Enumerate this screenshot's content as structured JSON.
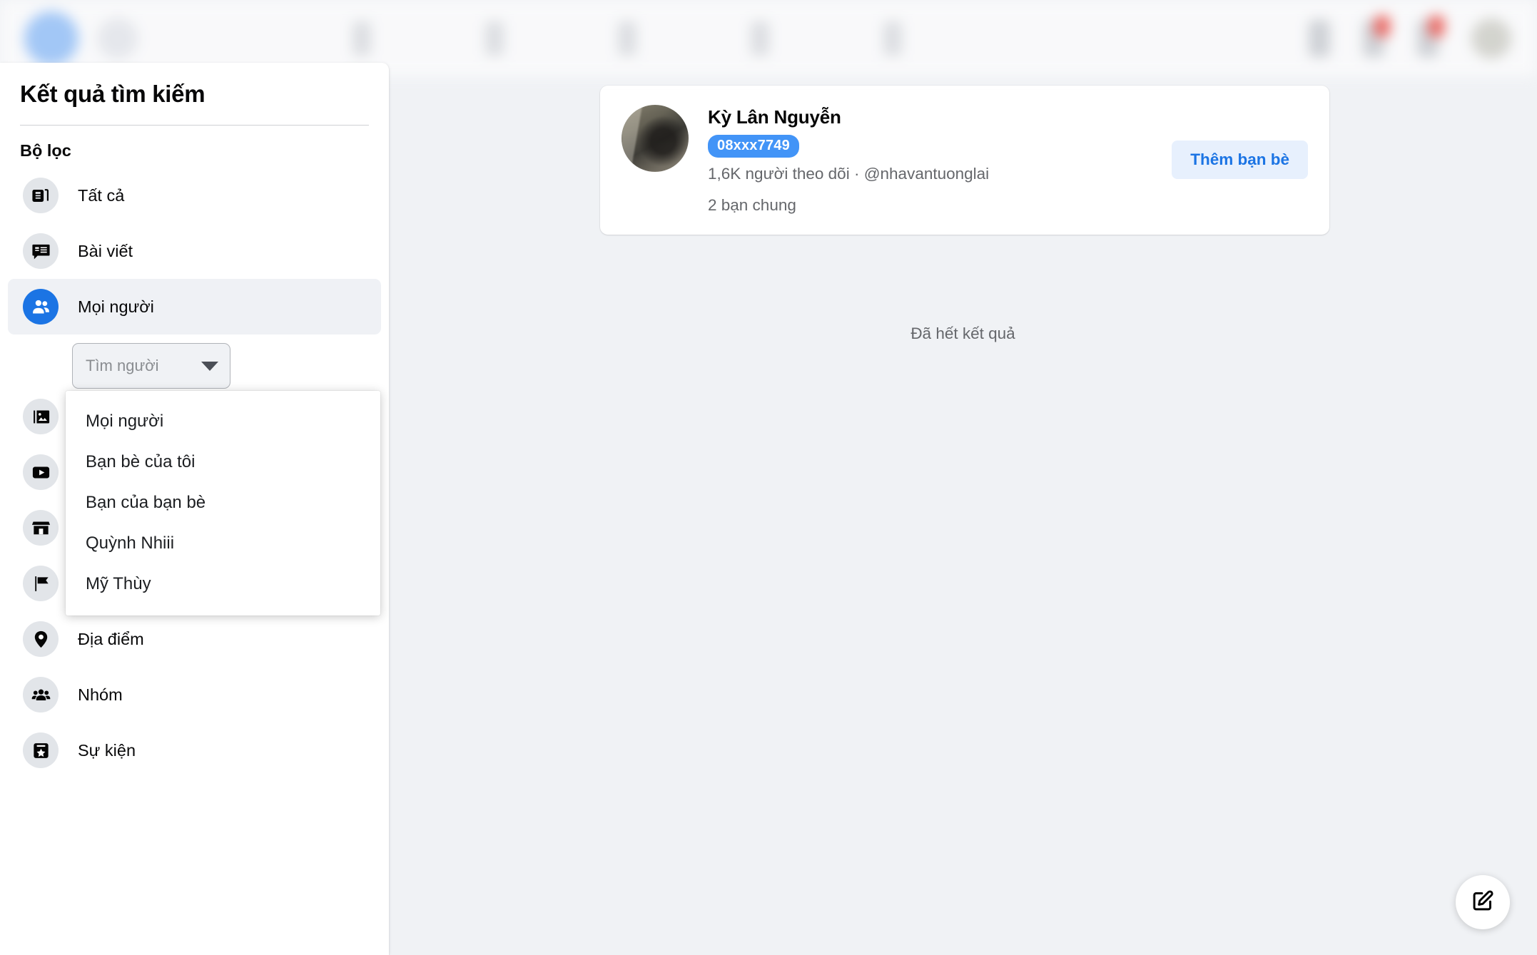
{
  "topbar": {
    "state": "blurred-loading",
    "logo_icon": "facebook-logo-icon",
    "search_icon": "search-icon",
    "nav_icon_count": 5,
    "right_icon_count": 3,
    "avatar_icon": "account-avatar",
    "notification_badge_color": "#e94c45",
    "brand_color": "#1877f2"
  },
  "sidebar": {
    "title": "Kết quả tìm kiếm",
    "filters_heading": "Bộ lọc",
    "items": [
      {
        "label": "Tất cả",
        "icon": "all-results-icon",
        "active": false
      },
      {
        "label": "Bài viết",
        "icon": "posts-icon",
        "active": false
      },
      {
        "label": "Mọi người",
        "icon": "people-icon",
        "active": true
      },
      {
        "label": "Ảnh",
        "icon": "photos-icon",
        "active": false
      },
      {
        "label": "Video",
        "icon": "video-icon",
        "active": false
      },
      {
        "label": "Marketplace",
        "icon": "marketplace-icon",
        "active": false
      },
      {
        "label": "Trang",
        "icon": "pages-icon",
        "active": false
      },
      {
        "label": "Địa điểm",
        "icon": "location-icon",
        "active": false
      },
      {
        "label": "Nhóm",
        "icon": "groups-icon",
        "active": false
      },
      {
        "label": "Sự kiện",
        "icon": "events-icon",
        "active": false
      }
    ],
    "people_select": {
      "placeholder": "Tìm người",
      "value": "",
      "caret_icon": "chevron-down-icon",
      "expanded": true,
      "options": [
        "Mọi người",
        "Bạn bè của tôi",
        "Bạn của bạn bè",
        "Quỳnh Nhiii",
        "Mỹ Thùy"
      ]
    }
  },
  "main": {
    "result": {
      "avatar": "profile-photo",
      "name": "Kỳ Lân Nguyễn",
      "badge": "08xxx7749",
      "badge_color": "#4294f7",
      "meta": "1,6K người theo dõi · @nhavantuonglai",
      "mutual_friends": "2 bạn chung",
      "action_label": "Thêm bạn bè",
      "action_color": "#1b74e4"
    },
    "end_of_results": "Đã hết kết quả"
  },
  "fab": {
    "icon": "compose-edit-icon",
    "label": "Tạo bài viết"
  }
}
